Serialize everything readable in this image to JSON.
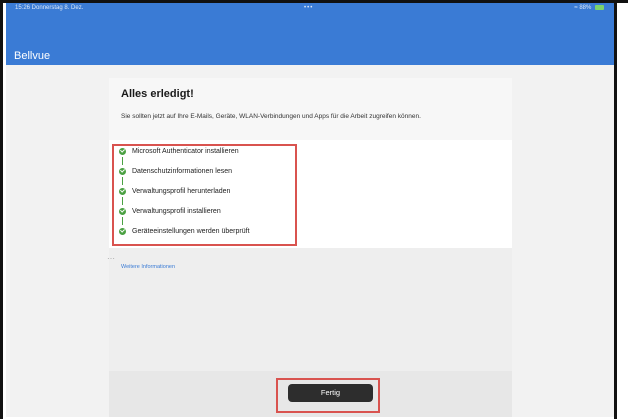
{
  "status_bar": {
    "time_date": "15:26 Donnerstag 8. Dez.",
    "center_dots": "•••",
    "right_info": "88%",
    "battery_color": "#7cd36b"
  },
  "header": {
    "app_title": "Bellvue",
    "background_color": "#3a7bd5"
  },
  "main": {
    "title": "Alles erledigt!",
    "description": "Sie sollten jetzt auf Ihre E-Mails, Geräte, WLAN-Verbindungen und Apps für die Arbeit zugreifen können.",
    "steps": [
      {
        "label": "Microsoft Authenticator installieren",
        "status": "complete",
        "icon": "check-circle-icon"
      },
      {
        "label": "Datenschutzinformationen lesen",
        "status": "complete",
        "icon": "check-circle-icon"
      },
      {
        "label": "Verwaltungsprofil herunterladen",
        "status": "complete",
        "icon": "check-circle-icon"
      },
      {
        "label": "Verwaltungsprofil installieren",
        "status": "complete",
        "icon": "check-circle-icon"
      },
      {
        "label": "Geräteeinstellungen werden überprüft",
        "status": "complete",
        "icon": "check-circle-icon"
      }
    ],
    "more_info_link": "Weitere Informationen",
    "done_button": "Fertig"
  },
  "colors": {
    "accent": "#3a7bd5",
    "success": "#4aa142",
    "highlight_box": "#d9534f",
    "button": "#2d2d2d"
  }
}
